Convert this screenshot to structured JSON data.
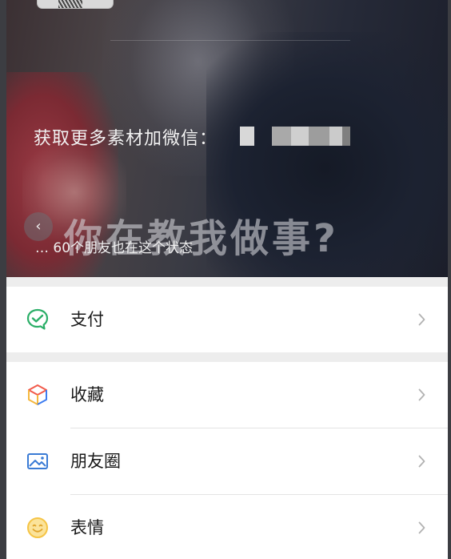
{
  "hero": {
    "watermark_text": "获取更多素材加微信：",
    "meme_caption": "你在教我做事?",
    "back_icon": "‹",
    "status_text": "…  60个朋友也在这个状态"
  },
  "menu": {
    "pay_label": "支付",
    "favorites_label": "收藏",
    "moments_label": "朋友圈",
    "stickers_label": "表情"
  },
  "icons": {
    "pay": "pay-icon",
    "favorites": "cube-icon",
    "moments": "picture-icon",
    "stickers": "smile-icon",
    "chevron": "chevron-right-icon",
    "back": "back-arrow-icon"
  },
  "colors": {
    "pay_green": "#2aae67",
    "favorites_red": "#f25a4a",
    "favorites_yellow": "#f5b83d",
    "favorites_blue": "#3d7cf0",
    "moments_blue": "#3a7bd5",
    "stickers_yellow": "#f5c445",
    "chevron_gray": "#b2b2b2"
  }
}
